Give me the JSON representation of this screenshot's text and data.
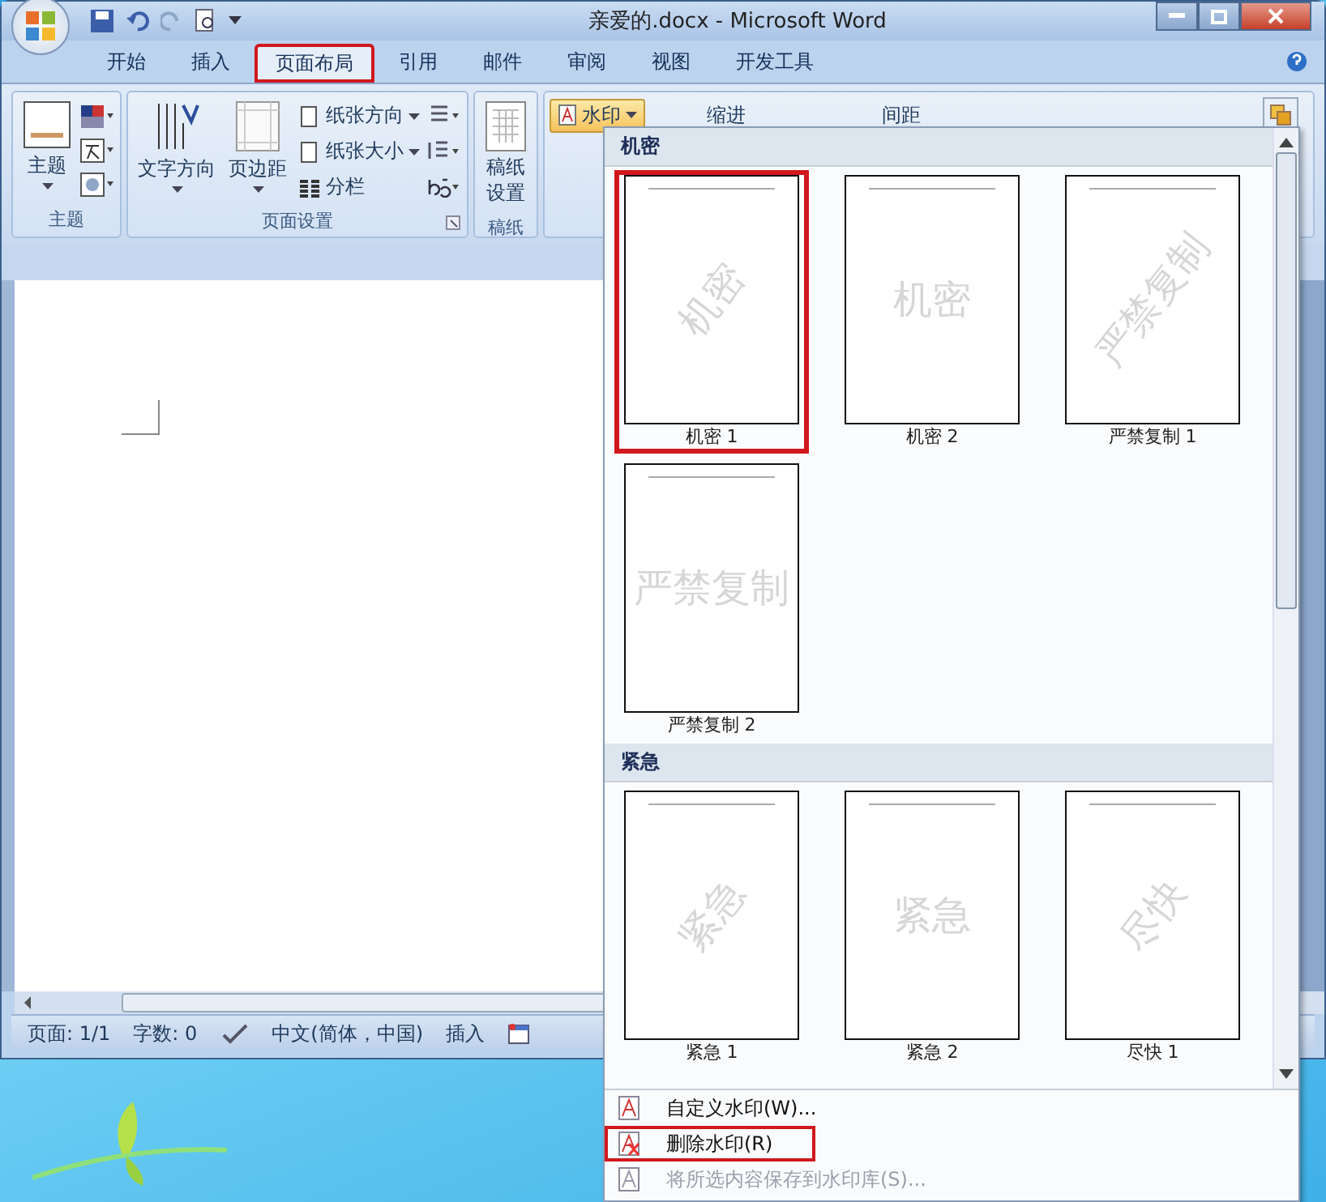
{
  "window": {
    "title": "亲爱的.docx - Microsoft Word"
  },
  "tabs": [
    {
      "label": "开始",
      "selected": false,
      "highlighted": false
    },
    {
      "label": "插入",
      "selected": false,
      "highlighted": false
    },
    {
      "label": "页面布局",
      "selected": true,
      "highlighted": true
    },
    {
      "label": "引用",
      "selected": false,
      "highlighted": false
    },
    {
      "label": "邮件",
      "selected": false,
      "highlighted": false
    },
    {
      "label": "审阅",
      "selected": false,
      "highlighted": false
    },
    {
      "label": "视图",
      "selected": false,
      "highlighted": false
    },
    {
      "label": "开发工具",
      "selected": false,
      "highlighted": false
    }
  ],
  "ribbon": {
    "theme_group": {
      "label": "主题",
      "button": "主题"
    },
    "page_setup_group": {
      "label": "页面设置",
      "big_buttons": [
        "文字方向",
        "页边距"
      ],
      "small_buttons": [
        "纸张方向",
        "纸张大小",
        "分栏"
      ]
    },
    "manuscript_group": {
      "label": "稿纸",
      "button": "稿纸设置"
    },
    "background_group": {
      "watermark_button": {
        "label": "水印",
        "open": true
      },
      "indent_label": "缩进",
      "spacing_label": "间距"
    }
  },
  "watermark_gallery": {
    "sections": [
      {
        "title": "机密",
        "items": [
          {
            "label": "机密 1",
            "watermark": "机密",
            "kind": "diagonal",
            "highlighted": true
          },
          {
            "label": "机密 2",
            "watermark": "机密",
            "kind": "horizontal",
            "highlighted": false
          },
          {
            "label": "严禁复制 1",
            "watermark": "严禁复制",
            "kind": "diagonal",
            "highlighted": false
          },
          {
            "label": "严禁复制 2",
            "watermark": "严禁复制",
            "kind": "horizontal",
            "highlighted": false
          }
        ]
      },
      {
        "title": "紧急",
        "items": [
          {
            "label": "紧急 1",
            "watermark": "紧急",
            "kind": "diagonal",
            "highlighted": false
          },
          {
            "label": "紧急 2",
            "watermark": "紧急",
            "kind": "horizontal",
            "highlighted": false
          },
          {
            "label": "尽快 1",
            "watermark": "尽快",
            "kind": "diagonal",
            "highlighted": false
          }
        ]
      }
    ],
    "menu": [
      {
        "label": "自定义水印(W)...",
        "disabled": false,
        "highlighted": false
      },
      {
        "label": "删除水印(R)",
        "disabled": false,
        "highlighted": true
      },
      {
        "label": "将所选内容保存到水印库(S)...",
        "disabled": true,
        "highlighted": false
      }
    ]
  },
  "status_bar": {
    "page": "页面: 1/1",
    "words": "字数: 0",
    "language": "中文(简体，中国)",
    "mode": "插入"
  }
}
